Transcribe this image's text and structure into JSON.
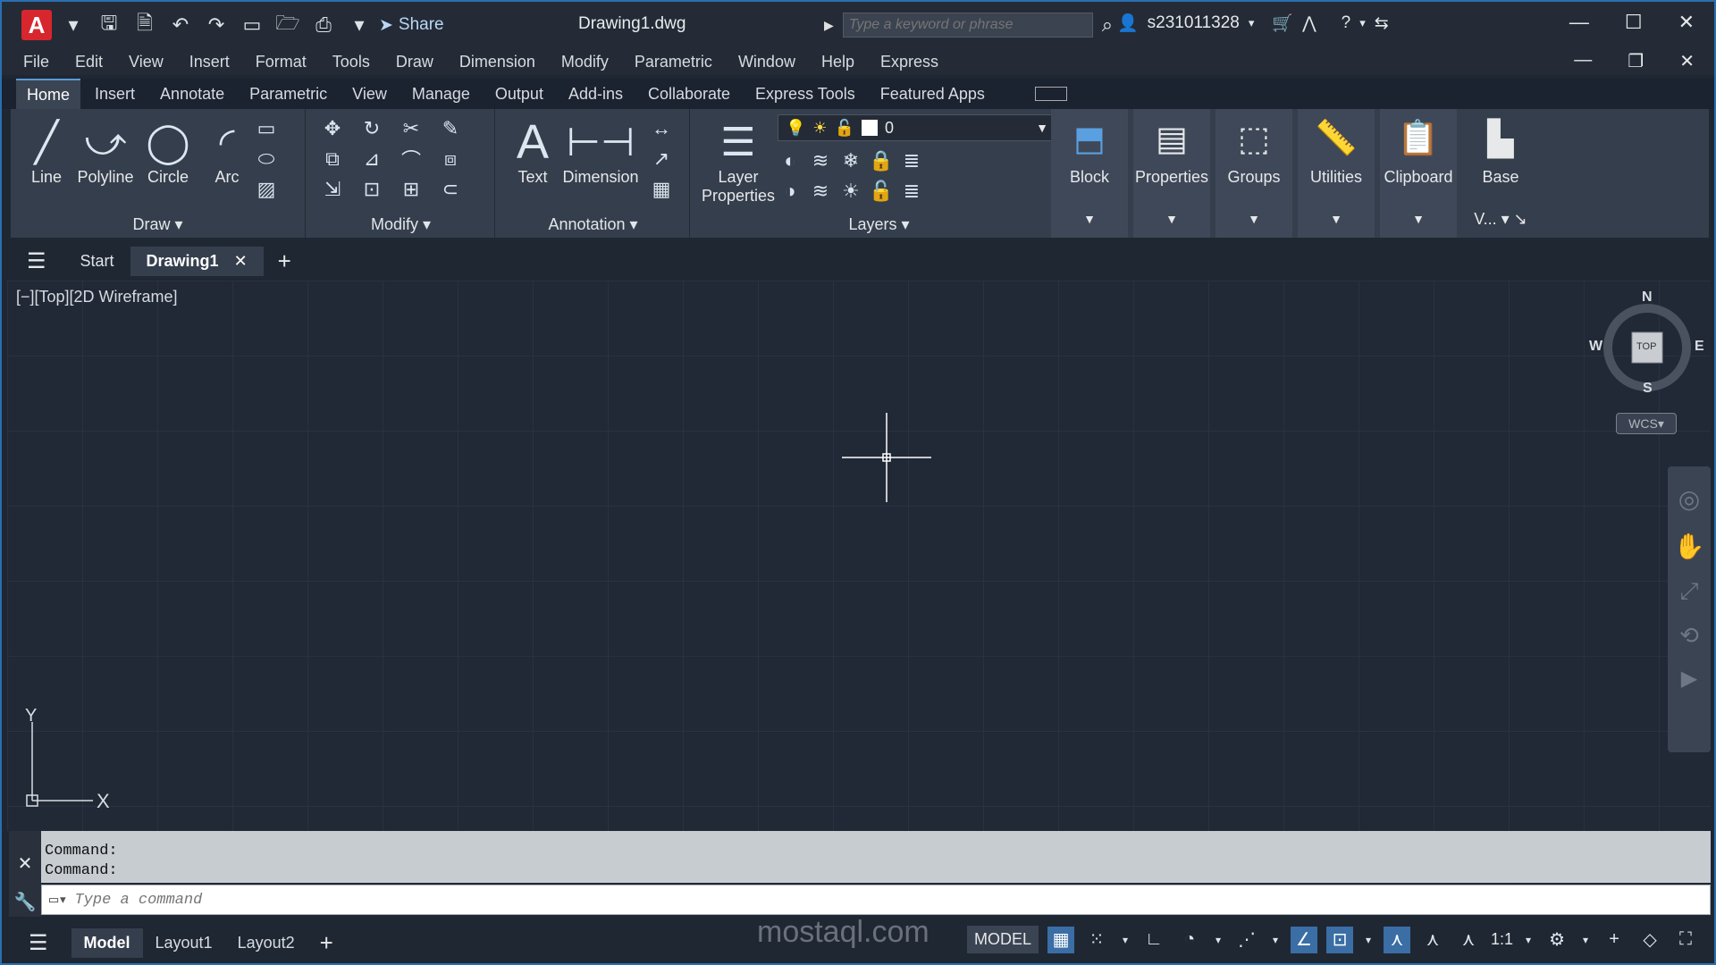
{
  "title_bar": {
    "app_letter": "A",
    "share_label": "Share",
    "document_title": "Drawing1.dwg",
    "search_placeholder": "Type a keyword or phrase",
    "username": "s231011328"
  },
  "menu_bar": [
    "File",
    "Edit",
    "View",
    "Insert",
    "Format",
    "Tools",
    "Draw",
    "Dimension",
    "Modify",
    "Parametric",
    "Window",
    "Help",
    "Express"
  ],
  "ribbon_tabs": [
    "Home",
    "Insert",
    "Annotate",
    "Parametric",
    "View",
    "Manage",
    "Output",
    "Add-ins",
    "Collaborate",
    "Express Tools",
    "Featured Apps"
  ],
  "ribbon": {
    "draw": {
      "title": "Draw",
      "tools": [
        "Line",
        "Polyline",
        "Circle",
        "Arc"
      ]
    },
    "modify": {
      "title": "Modify"
    },
    "annotation": {
      "title": "Annotation",
      "tools": [
        "Text",
        "Dimension"
      ]
    },
    "layers": {
      "title": "Layers",
      "layer_properties_line1": "Layer",
      "layer_properties_line2": "Properties",
      "current_layer": "0"
    },
    "groups": [
      "Block",
      "Properties",
      "Groups",
      "Utilities",
      "Clipboard",
      "Base"
    ],
    "view_short": "V..."
  },
  "doc_tabs": {
    "start": "Start",
    "active": "Drawing1"
  },
  "viewport": {
    "label": "[−][Top][2D Wireframe]",
    "compass": {
      "n": "N",
      "s": "S",
      "e": "E",
      "w": "W",
      "cube_face": "TOP"
    },
    "wcs": "WCS",
    "ucs_x": "X",
    "ucs_y": "Y"
  },
  "command": {
    "history": [
      "Command:",
      "Command:"
    ],
    "placeholder": "Type a command"
  },
  "status_bar": {
    "layouts": [
      "Model",
      "Layout1",
      "Layout2"
    ],
    "model_label": "MODEL",
    "scale": "1:1"
  },
  "watermark": "mostaql.com"
}
